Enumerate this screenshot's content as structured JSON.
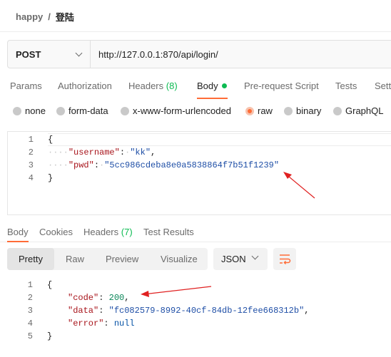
{
  "breadcrumb": {
    "workspace": "happy",
    "separator": "/",
    "page": "登陆"
  },
  "request": {
    "method": "POST",
    "url": "http://127.0.0.1:870/api/login/"
  },
  "request_tabs": {
    "params": "Params",
    "authorization": "Authorization",
    "headers": "Headers",
    "headers_count": "(8)",
    "body": "Body",
    "prerequest": "Pre-request Script",
    "tests": "Tests",
    "settings": "Setti"
  },
  "body_types": {
    "none": "none",
    "form_data": "form-data",
    "urlencoded": "x-www-form-urlencoded",
    "raw": "raw",
    "binary": "binary",
    "graphql": "GraphQL",
    "selected": "raw"
  },
  "request_body": {
    "line_numbers": [
      "1",
      "2",
      "3",
      "4"
    ],
    "open_brace": "{",
    "close_brace": "}",
    "username_key": "\"username\"",
    "username_value": "\"kk\"",
    "pwd_key": "\"pwd\"",
    "pwd_value": "\"5cc986cdeba8e0a5838864f7b51f1239\""
  },
  "response_tabs": {
    "body": "Body",
    "cookies": "Cookies",
    "headers": "Headers",
    "headers_count": "(7)",
    "test_results": "Test Results"
  },
  "response_view": {
    "pretty": "Pretty",
    "raw": "Raw",
    "preview": "Preview",
    "visualize": "Visualize",
    "format": "JSON"
  },
  "response_body": {
    "line_numbers": [
      "1",
      "2",
      "3",
      "4",
      "5"
    ],
    "open_brace": "{",
    "close_brace": "}",
    "code_key": "\"code\"",
    "code_value": "200",
    "data_key": "\"data\"",
    "data_value": "\"fc082579-8992-40cf-84db-12fee668312b\"",
    "error_key": "\"error\"",
    "error_value": "null"
  },
  "colors": {
    "accent": "#ff6c37",
    "success": "#0cbb52",
    "annotation": "#e02020"
  },
  "icons": {
    "method_dropdown": "chevron-down-icon",
    "format_dropdown": "chevron-down-icon",
    "wrap": "wrap-lines-icon"
  }
}
